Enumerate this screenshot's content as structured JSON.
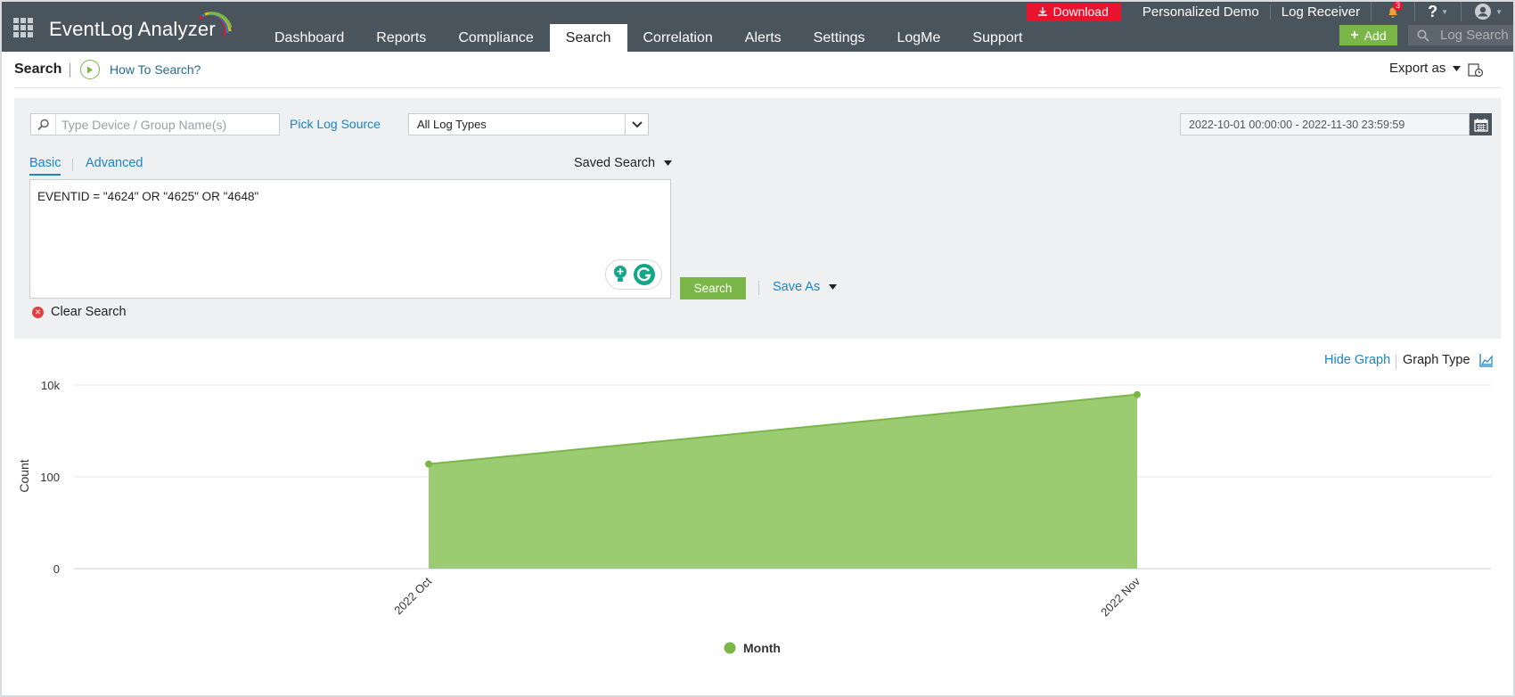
{
  "app": {
    "brand": "EventLog Analyzer"
  },
  "nav": {
    "tabs": [
      "Dashboard",
      "Reports",
      "Compliance",
      "Search",
      "Correlation",
      "Alerts",
      "Settings",
      "LogMe",
      "Support"
    ],
    "active": "Search"
  },
  "topbar": {
    "download_label": "Download",
    "personalized_demo": "Personalized Demo",
    "log_receiver": "Log Receiver",
    "notification_count": "3",
    "help_label": "?",
    "add_label": "Add",
    "log_search_placeholder": "Log Search"
  },
  "page": {
    "title": "Search",
    "how_to": "How To Search?",
    "export_label": "Export as"
  },
  "search": {
    "device_placeholder": "Type Device / Group Name(s)",
    "pick_log_source": "Pick Log Source",
    "log_type": "All Log Types",
    "date_range": "2022-10-01 00:00:00 - 2022-11-30 23:59:59",
    "tab_basic": "Basic",
    "tab_advanced": "Advanced",
    "saved_search": "Saved Search",
    "query": "EVENTID = \"4624\" OR \"4625\" OR \"4648\"",
    "search_button": "Search",
    "save_as": "Save As",
    "clear_search": "Clear Search"
  },
  "graph": {
    "hide_graph": "Hide Graph",
    "graph_type": "Graph Type"
  },
  "colors": {
    "topbar": "#4a545d",
    "accent_green": "#7ab648",
    "area_fill": "#9ccc71",
    "area_line": "#7ab648",
    "link_blue": "#1a84c7",
    "download_red": "#e8142d"
  },
  "chart_data": {
    "type": "area",
    "categories": [
      "2022 Oct",
      "2022 Nov"
    ],
    "series": [
      {
        "name": "Month",
        "values": [
          190,
          6200
        ]
      }
    ],
    "ylabel": "Count",
    "xlabel": "",
    "y_ticks": [
      "0",
      "100",
      "10k"
    ],
    "y_scale": "log",
    "grid": true,
    "legend": "bottom-center"
  }
}
